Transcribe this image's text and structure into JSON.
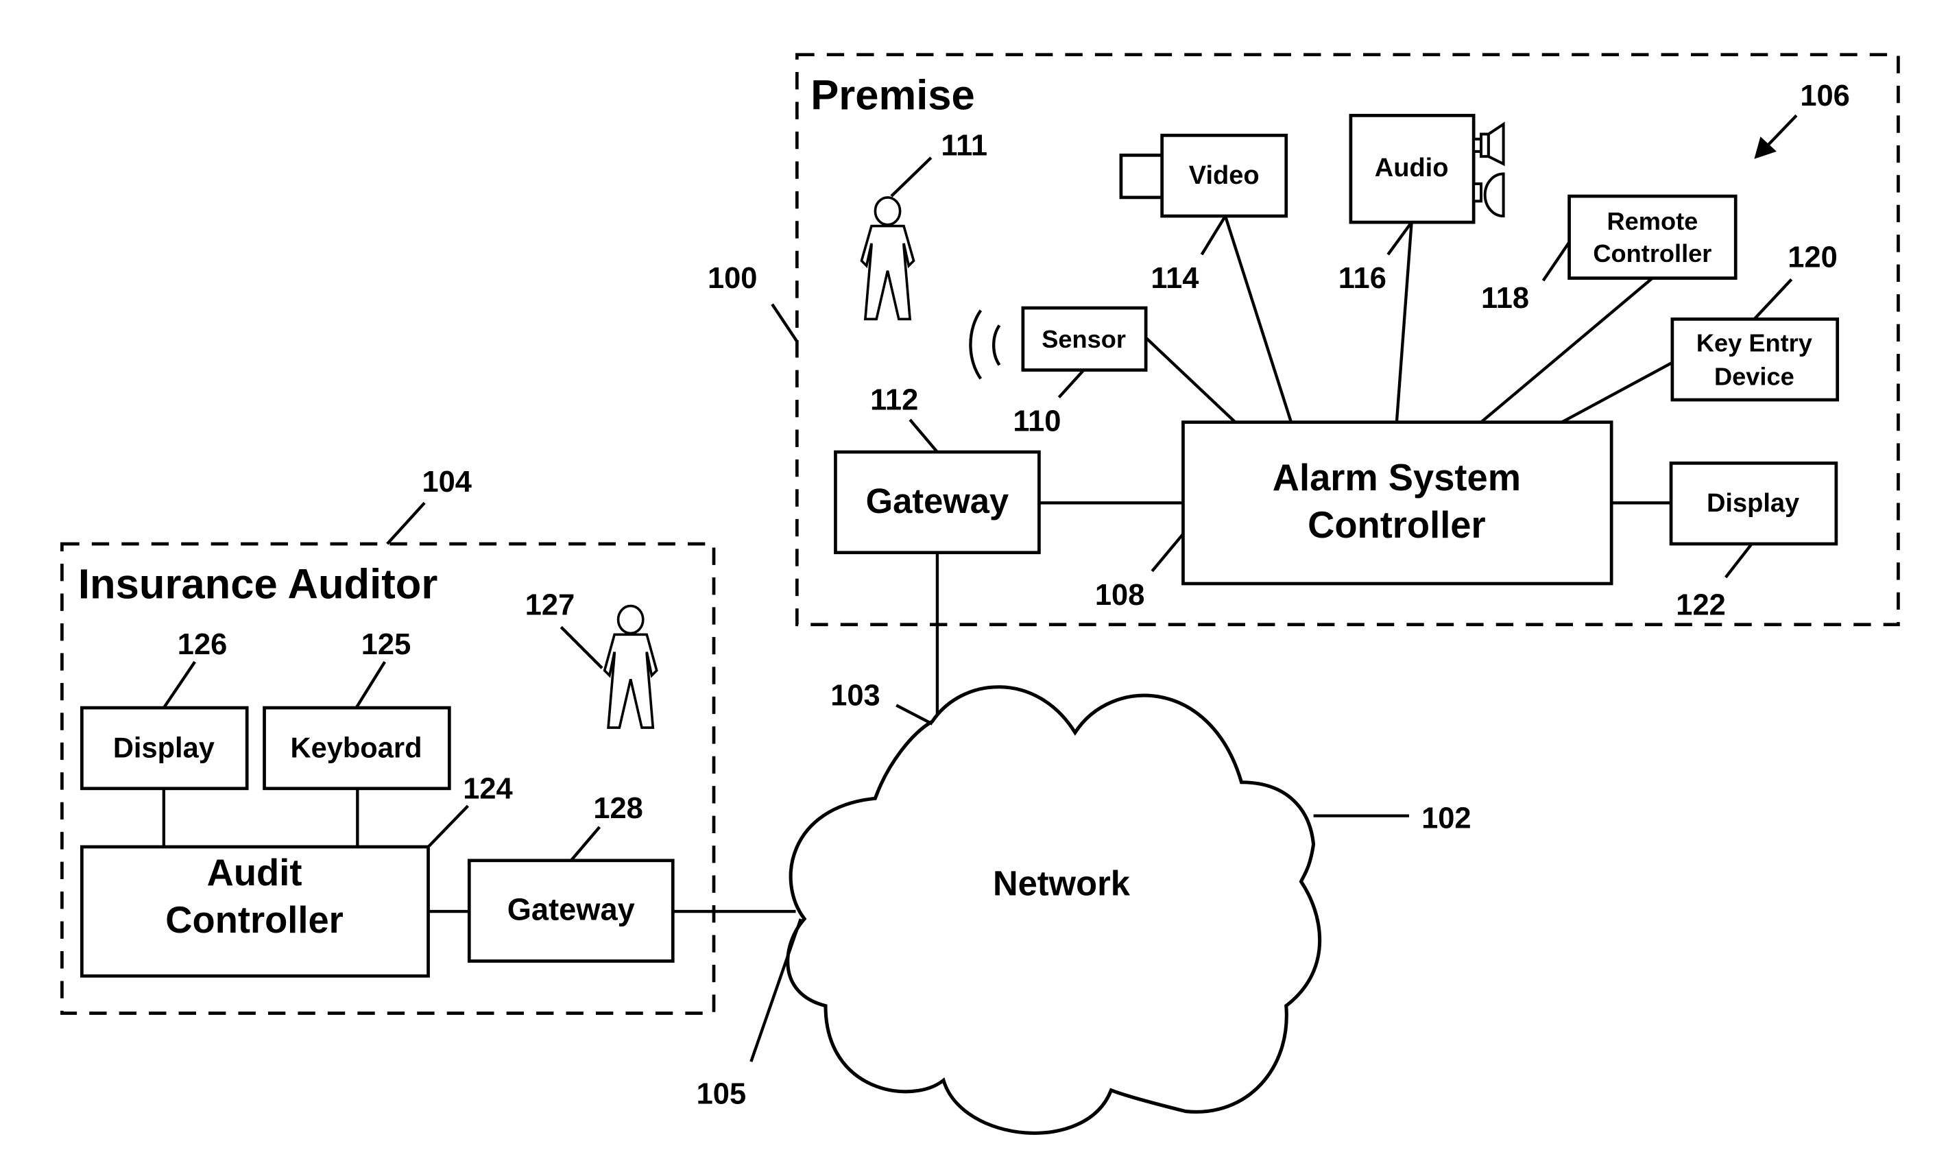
{
  "premise": {
    "title": "Premise",
    "ref": "100",
    "system_ref": "106",
    "person_ref": "111",
    "gateway": {
      "label": "Gateway",
      "ref": "112"
    },
    "alarm_controller": {
      "line1": "Alarm System",
      "line2": "Controller",
      "ref": "108"
    },
    "sensor": {
      "label": "Sensor",
      "ref": "110"
    },
    "video": {
      "label": "Video",
      "ref": "114"
    },
    "audio": {
      "label": "Audio",
      "ref": "116"
    },
    "remote_controller": {
      "line1": "Remote",
      "line2": "Controller",
      "ref": "118"
    },
    "key_entry": {
      "line1": "Key Entry",
      "line2": "Device",
      "ref": "120"
    },
    "display": {
      "label": "Display",
      "ref": "122"
    }
  },
  "auditor": {
    "title": "Insurance Auditor",
    "ref": "104",
    "person_ref": "127",
    "display": {
      "label": "Display",
      "ref": "126"
    },
    "keyboard": {
      "label": "Keyboard",
      "ref": "125"
    },
    "audit_controller": {
      "line1": "Audit",
      "line2": "Controller",
      "ref": "124"
    },
    "gateway": {
      "label": "Gateway",
      "ref": "128"
    }
  },
  "network": {
    "label": "Network",
    "ref": "102",
    "premise_link_ref": "103",
    "auditor_link_ref": "105"
  }
}
